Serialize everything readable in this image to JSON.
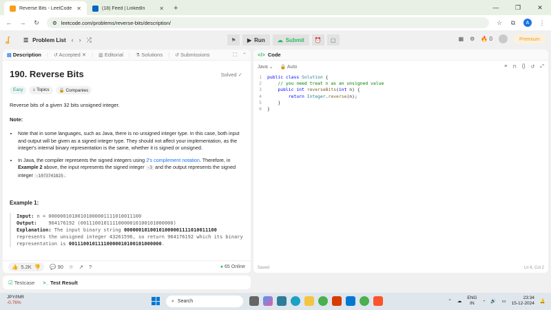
{
  "browser": {
    "tabs": [
      {
        "title": "Reverse Bits - LeetCode",
        "active": true
      },
      {
        "title": "(18) Feed | LinkedIn",
        "active": false
      }
    ],
    "url": "leetcode.com/problems/reverse-bits/description/",
    "profile_initial": "A"
  },
  "header": {
    "problem_list": "Problem List",
    "run": "Run",
    "submit": "Submit",
    "streak": "0",
    "premium": "Premium"
  },
  "left_tabs": [
    "Description",
    "Accepted",
    "Editorial",
    "Solutions",
    "Submissions"
  ],
  "problem": {
    "title": "190. Reverse Bits",
    "status": "Solved",
    "difficulty": "Easy",
    "topics": "Topics",
    "companies": "Companies",
    "statement": "Reverse bits of a given 32 bits unsigned integer.",
    "note_label": "Note:",
    "note1": "Note that in some languages, such as Java, there is no unsigned integer type. In this case, both input and output will be given as a signed integer type. They should not affect your implementation, as the integer's internal binary representation is the same, whether it is signed or unsigned.",
    "note2_a": "In Java, the compiler represents the signed integers using ",
    "note2_link": "2's complement notation",
    "note2_b": ". Therefore, in ",
    "note2_bold": "Example 2",
    "note2_c": " above, the input represents the signed integer ",
    "note2_code1": "-3",
    "note2_d": " and the output represents the signed integer ",
    "note2_code2": "-1073741825",
    "note2_e": ".",
    "example_title": "Example 1:",
    "input_label": "Input:",
    "input_value": " n = 00000010100101000001111010011100",
    "output_label": "Output:",
    "output_value": "    964176192 (00111001011110000010100101000000)",
    "explanation_label": "Explanation:",
    "explanation_a": " The input binary string ",
    "explanation_bin1": "00000010100101000001111010011100",
    "explanation_b": " represents the unsigned integer 43261596, so return 964176192 which its binary representation is ",
    "explanation_bin2": "00111001011110000010100101000000",
    "explanation_c": "."
  },
  "footer": {
    "likes": "5.2K",
    "comments": "90",
    "online": "65 Online"
  },
  "code": {
    "title": "Code",
    "language": "Java",
    "auto": "Auto",
    "lines": [
      "public class Solution {",
      "    // you need treat n as an unsigned value",
      "    public int reverseBits(int n) {",
      "        return Integer.reverse(n);",
      "    }",
      "}"
    ],
    "saved": "Saved",
    "cursor": "Ln 6, Col 2"
  },
  "bottom": {
    "testcase": "Testcase",
    "test_result": "Test Result"
  },
  "taskbar": {
    "ticker_name": "JPY/INR",
    "ticker_change": "-0.76%",
    "search": "Search",
    "lang1": "ENG",
    "lang2": "IN",
    "time": "23:34",
    "date": "15-12-2024"
  }
}
